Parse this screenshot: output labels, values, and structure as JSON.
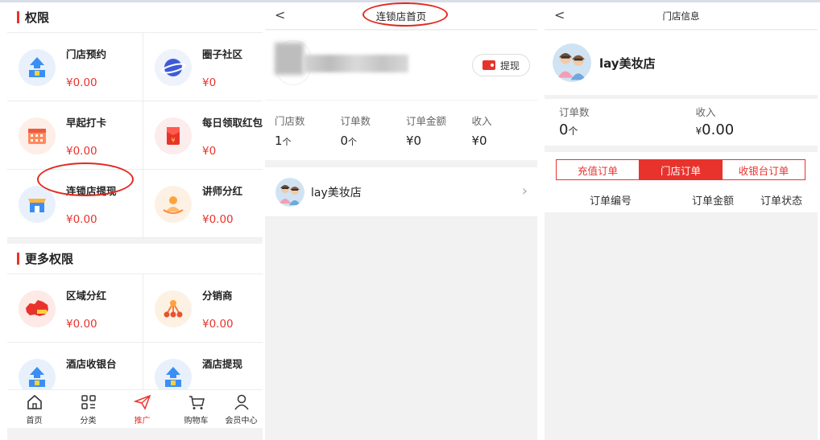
{
  "panel1": {
    "section1_title": "权限",
    "section2_title": "更多权限",
    "items": [
      {
        "name": "门店预约",
        "price": "¥0.00",
        "icon": "upload-store-icon"
      },
      {
        "name": "圈子社区",
        "price": "¥0",
        "icon": "planet-icon"
      },
      {
        "name": "早起打卡",
        "price": "¥0.00",
        "icon": "calendar-icon"
      },
      {
        "name": "每日领取红包",
        "price": "¥0",
        "icon": "red-envelope-icon"
      },
      {
        "name": "连锁店提现",
        "price": "¥0.00",
        "icon": "shop-icon"
      },
      {
        "name": "讲师分红",
        "price": "¥0.00",
        "icon": "lecturer-icon"
      }
    ],
    "more_items": [
      {
        "name": "区域分红",
        "price": "¥0.00",
        "icon": "china-map-icon"
      },
      {
        "name": "分销商",
        "price": "¥0.00",
        "icon": "network-icon"
      },
      {
        "name": "酒店收银台",
        "price": "",
        "icon": "upload-store-icon"
      },
      {
        "name": "酒店提现",
        "price": "",
        "icon": "upload-store-icon"
      }
    ],
    "tabbar": [
      {
        "label": "首页",
        "icon": "home-icon"
      },
      {
        "label": "分类",
        "icon": "category-icon"
      },
      {
        "label": "推广",
        "icon": "paper-plane-icon",
        "active": true
      },
      {
        "label": "购物车",
        "icon": "cart-icon"
      },
      {
        "label": "会员中心",
        "icon": "user-icon"
      }
    ]
  },
  "panel2": {
    "title": "连锁店首页",
    "back": "<",
    "withdraw": "提现",
    "stats": [
      {
        "label": "门店数",
        "value": "1",
        "unit": "个"
      },
      {
        "label": "订单数",
        "value": "0",
        "unit": "个"
      },
      {
        "label": "订单金额",
        "value": "¥0",
        "unit": ""
      },
      {
        "label": "收入",
        "value": "¥0",
        "unit": ""
      }
    ],
    "store_name": "lay美妆店",
    "chevron": "›"
  },
  "panel3": {
    "title": "门店信息",
    "back": "<",
    "store_name": "lay美妆店",
    "order_count_label": "订单数",
    "order_count": "0",
    "order_count_unit": "个",
    "income_label": "收入",
    "income_currency": "¥",
    "income": "0.00",
    "segments": [
      "充值订单",
      "门店订单",
      "收银台订单"
    ],
    "active_segment": 1,
    "columns": [
      "订单编号",
      "订单金额",
      "订单状态"
    ]
  },
  "colors": {
    "accent": "#e8332d",
    "background": "#f2f2f2"
  }
}
